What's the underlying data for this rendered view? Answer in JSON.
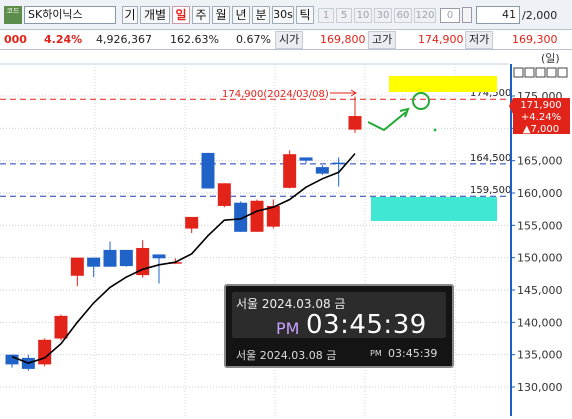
{
  "toolbar": {
    "code_button": "코드",
    "stock_name": "SK하이닉스",
    "timeframes": [
      "기",
      "개별",
      "일",
      "주",
      "월",
      "년",
      "분",
      "30s",
      "틱"
    ],
    "active_timeframe": "일",
    "minute_buttons": [
      "1",
      "5",
      "10",
      "30",
      "60",
      "120"
    ],
    "interval_value": "0",
    "period_count": "41",
    "period_total": "/2,000"
  },
  "quote": {
    "change": "000",
    "change_pct": "4.24%",
    "volume": "4,926,367",
    "volume_ratio": "162.63%",
    "turnover_pct": "0.67%",
    "open_label": "시가",
    "open_value": "169,800",
    "high_label": "고가",
    "high_value": "174,900",
    "low_label": "저가",
    "low_value": "169,300"
  },
  "chart": {
    "unit_label": "(일)",
    "high_annotation": "174,900(2024/03/08)",
    "current_price": "171,900",
    "current_change": "+4.24%",
    "current_diff": "▲7,000",
    "level_labels": [
      "174,500",
      "164,500",
      "159,500"
    ],
    "colors": {
      "up": "#e2231a",
      "down": "#1f62c8",
      "ma": "#000000",
      "yellow_box": "#ffff00",
      "cyan_box": "#40e8d4",
      "arrow": "#22aa33",
      "axis": "#1b5fc4"
    }
  },
  "chart_data": {
    "type": "candlestick",
    "y_ticks": [
      "175,000",
      "170,000",
      "165,000",
      "160,000",
      "155,000",
      "150,000",
      "145,000",
      "140,000",
      "135,000",
      "130,000"
    ],
    "ylim": [
      128000,
      178000
    ],
    "levels": [
      174500,
      164500,
      159500
    ],
    "candles": [
      {
        "o": 135000,
        "h": 135000,
        "l": 133000,
        "c": 133500
      },
      {
        "o": 134500,
        "h": 135000,
        "l": 132500,
        "c": 132800
      },
      {
        "o": 133500,
        "h": 137500,
        "l": 133200,
        "c": 137300
      },
      {
        "o": 137500,
        "h": 141200,
        "l": 137200,
        "c": 141000
      },
      {
        "o": 147200,
        "h": 150000,
        "l": 145600,
        "c": 150000
      },
      {
        "o": 150000,
        "h": 150000,
        "l": 147000,
        "c": 148600
      },
      {
        "o": 151200,
        "h": 152500,
        "l": 148600,
        "c": 148600
      },
      {
        "o": 151200,
        "h": 151200,
        "l": 148600,
        "c": 148700
      },
      {
        "o": 147300,
        "h": 152700,
        "l": 146900,
        "c": 151500
      },
      {
        "o": 150500,
        "h": 150500,
        "l": 146000,
        "c": 149900
      },
      {
        "o": 149300,
        "h": 149900,
        "l": 149000,
        "c": 149300
      },
      {
        "o": 154500,
        "h": 156000,
        "l": 153800,
        "c": 156300
      },
      {
        "o": 166200,
        "h": 166200,
        "l": 160700,
        "c": 160700
      },
      {
        "o": 158000,
        "h": 161500,
        "l": 157800,
        "c": 161500
      },
      {
        "o": 158500,
        "h": 158700,
        "l": 154000,
        "c": 154000
      },
      {
        "o": 154000,
        "h": 159000,
        "l": 154000,
        "c": 158800
      },
      {
        "o": 154800,
        "h": 159000,
        "l": 154500,
        "c": 158000
      },
      {
        "o": 160800,
        "h": 166600,
        "l": 160700,
        "c": 166000
      },
      {
        "o": 165500,
        "h": 165500,
        "l": 164600,
        "c": 165000
      },
      {
        "o": 164000,
        "h": 164300,
        "l": 162800,
        "c": 163000
      },
      {
        "o": 164700,
        "h": 165500,
        "l": 161000,
        "c": 164600
      },
      {
        "o": 169800,
        "h": 174900,
        "l": 169300,
        "c": 171900
      }
    ],
    "ma": [
      134700,
      133700,
      134500,
      136700,
      140000,
      143000,
      145400,
      147000,
      148200,
      148900,
      149300,
      150600,
      153400,
      155800,
      156000,
      157200,
      157800,
      159000,
      160900,
      162200,
      163200,
      166100
    ]
  },
  "clock": {
    "date": "서울 2024.03.08 금",
    "ampm": "PM",
    "time": "03:45:39",
    "date_small": "서울 2024.03.08 금",
    "ampm_small": "PM",
    "time_small": "03:45:39"
  }
}
